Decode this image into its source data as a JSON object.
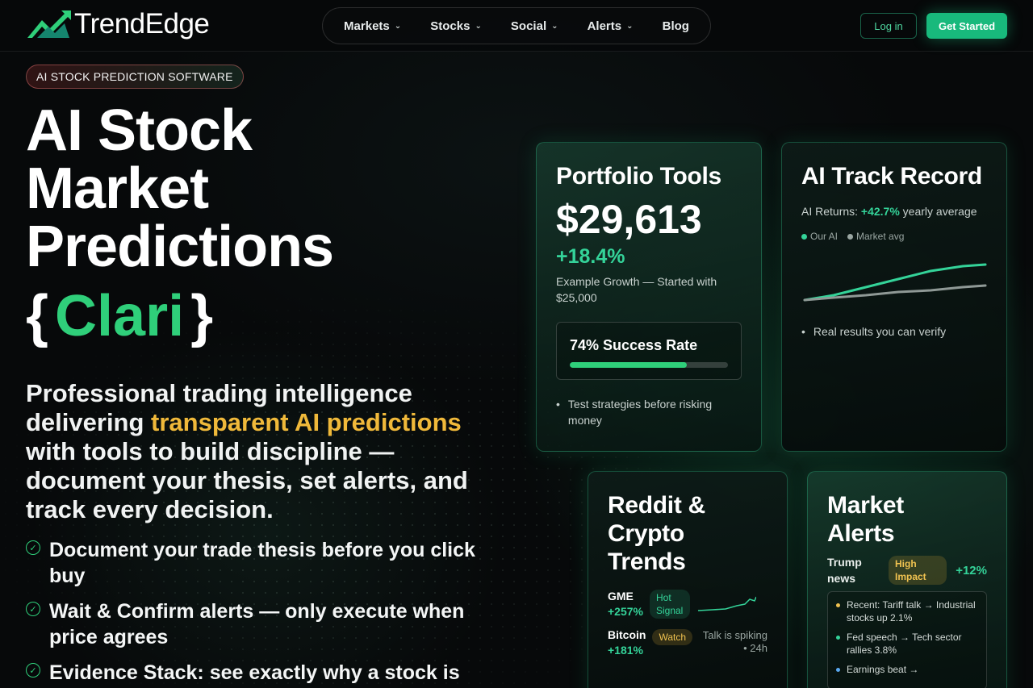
{
  "brand": {
    "name": "TrendEdge",
    "accent": "#2fcf7a",
    "highlight": "#f0b93a"
  },
  "nav": {
    "items": [
      {
        "label": "Markets",
        "has_dropdown": true
      },
      {
        "label": "Stocks",
        "has_dropdown": true
      },
      {
        "label": "Social",
        "has_dropdown": true
      },
      {
        "label": "Alerts",
        "has_dropdown": true
      },
      {
        "label": "Blog",
        "has_dropdown": false
      }
    ],
    "login_label": "Log in",
    "cta_label": "Get Started"
  },
  "hero": {
    "badge": "AI STOCK PREDICTION SOFTWARE",
    "title_lines": [
      "AI Stock",
      "Market",
      "Predictions"
    ],
    "clari": {
      "open": "{",
      "name": "Clari",
      "close": "}"
    },
    "subtitle_pre": "Professional trading intelligence delivering ",
    "subtitle_highlight": "transparent AI predictions",
    "subtitle_post": " with tools to build discipline — document your thesis, set alerts, and track every decision.",
    "features": [
      "Document your trade thesis before you click buy",
      "Wait & Confirm alerts — only execute when price agrees",
      "Evidence Stack: see exactly why a stock is"
    ]
  },
  "cards": {
    "portfolio": {
      "title": "Portfolio Tools",
      "value": "$29,613",
      "growth": "+18.4%",
      "caption": "Example Growth — Started with $25,000",
      "success_label": "74% Success Rate",
      "success_rate": 0.74,
      "bullet": "Test strategies before risking money"
    },
    "track": {
      "title": "AI Track Record",
      "returns_pre": "AI Returns: ",
      "returns_value": "+42.7%",
      "returns_post": " yearly average",
      "legend_ai": "Our AI",
      "legend_market": "Market avg",
      "bullet": "Real results you can verify"
    },
    "reddit": {
      "title": "Reddit & Crypto Trends",
      "items": [
        {
          "name": "GME",
          "pct": "+257%",
          "tag": "Hot Signal"
        },
        {
          "name": "Bitcoin",
          "pct": "+181%",
          "tag": "Watch"
        }
      ],
      "note": "Talk is spiking • 24h"
    },
    "alerts": {
      "title": "Market Alerts",
      "topic": "Trump news",
      "impact": "High Impact",
      "impact_pct": "+12%",
      "news": [
        {
          "text": "Recent: Tariff talk → Industrial stocks up 2.1%",
          "color": "#f0c250"
        },
        {
          "text": "Fed speech → Tech sector rallies 3.8%",
          "color": "#34d399"
        },
        {
          "text": "Earnings beat →",
          "color": "#5aa9f0"
        }
      ]
    }
  }
}
